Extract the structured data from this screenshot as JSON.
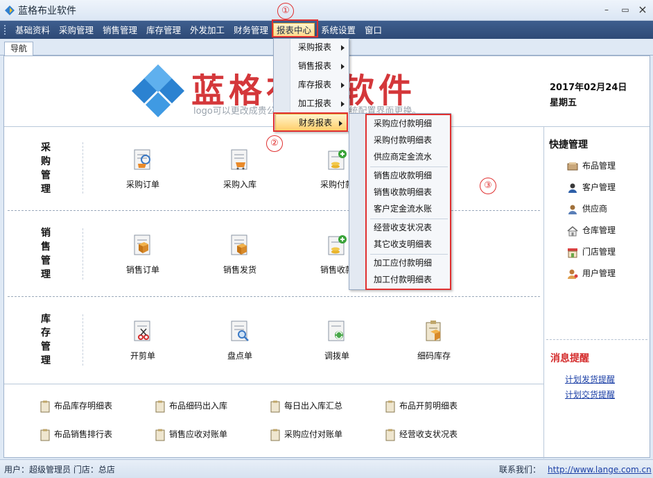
{
  "app": {
    "title": "蓝格布业软件",
    "minimize": "–",
    "restore": "▭",
    "close": "×"
  },
  "menubar": {
    "items": [
      "基础资料",
      "采购管理",
      "销售管理",
      "库存管理",
      "外发加工",
      "财务管理",
      "报表中心",
      "系统设置",
      "窗口"
    ]
  },
  "tabs": [
    "导航"
  ],
  "header": {
    "logo_text": "蓝格布业软件",
    "logo_sub": "logo可以更改成贵公司的logo，请在系统配置界面更换。",
    "date": "2017年02月24日",
    "weekday": "星期五"
  },
  "sections": {
    "purchase": {
      "label": "采购管理",
      "tiles": [
        "采购订单",
        "采购入库",
        "采购付款"
      ]
    },
    "sales": {
      "label": "销售管理",
      "tiles": [
        "销售订单",
        "销售发货",
        "销售收款"
      ]
    },
    "stock": {
      "label": "库存管理",
      "tiles": [
        "开剪单",
        "盘点单",
        "调拨单",
        "细码库存"
      ]
    }
  },
  "reports": [
    "布品库存明细表",
    "布品细码出入库",
    "每日出入库汇总",
    "布品开剪明细表",
    "布品销售排行表",
    "销售应收对账单",
    "采购应付对账单",
    "经营收支状况表"
  ],
  "quick": {
    "title": "快捷管理",
    "items": [
      "布品管理",
      "客户管理",
      "供应商",
      "仓库管理",
      "门店管理",
      "用户管理"
    ]
  },
  "messages": {
    "title": "消息提醒",
    "links": [
      "计划发货提醒",
      "计划交货提醒"
    ]
  },
  "status": {
    "user": "用户：超级管理员   门店：总店",
    "contact_label": "联系我们：",
    "contact_url": "http://www.lange.com.cn"
  },
  "report_menu": {
    "items": [
      "采购报表",
      "销售报表",
      "库存报表",
      "加工报表",
      "财务报表"
    ],
    "highlighted": "财务报表"
  },
  "finance_submenu": {
    "items": [
      "采购应付款明细",
      "采购付款明细表",
      "供应商定金流水",
      "销售应收款明细",
      "销售收款明细表",
      "客户定金流水账",
      "经营收支状况表",
      "其它收支明细表",
      "加工应付款明细",
      "加工付款明细表"
    ]
  },
  "annotations": [
    "①",
    "②",
    "③"
  ],
  "colors": {
    "menubar": "#2e4a76",
    "logo_red": "#d4373a",
    "annotation_red": "#e03030",
    "highlight": "#ffd98a",
    "link_blue": "#1b3fa6"
  }
}
